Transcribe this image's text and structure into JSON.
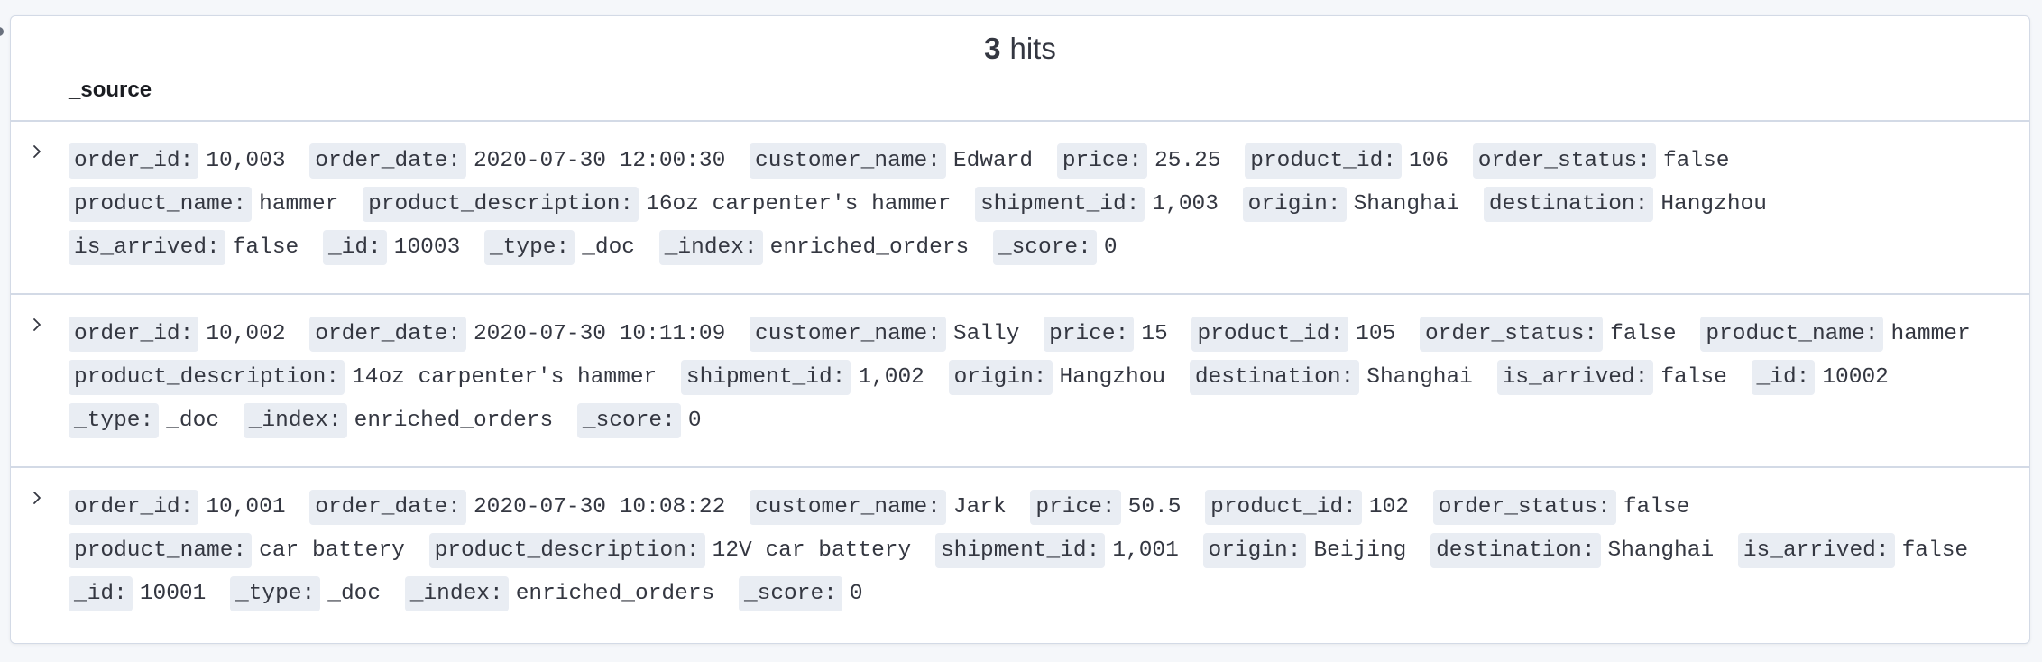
{
  "hits": {
    "count": "3",
    "label": "hits"
  },
  "table": {
    "column_header": "_source",
    "rows": [
      {
        "fields": [
          {
            "key": "order_id:",
            "value": "10,003"
          },
          {
            "key": "order_date:",
            "value": "2020-07-30 12:00:30"
          },
          {
            "key": "customer_name:",
            "value": "Edward"
          },
          {
            "key": "price:",
            "value": "25.25"
          },
          {
            "key": "product_id:",
            "value": "106"
          },
          {
            "key": "order_status:",
            "value": "false"
          },
          {
            "key": "product_name:",
            "value": "hammer"
          },
          {
            "key": "product_description:",
            "value": "16oz carpenter's hammer"
          },
          {
            "key": "shipment_id:",
            "value": "1,003"
          },
          {
            "key": "origin:",
            "value": "Shanghai"
          },
          {
            "key": "destination:",
            "value": "Hangzhou"
          },
          {
            "key": "is_arrived:",
            "value": "false"
          },
          {
            "key": "_id:",
            "value": "10003"
          },
          {
            "key": "_type:",
            "value": "_doc"
          },
          {
            "key": "_index:",
            "value": "enriched_orders"
          },
          {
            "key": "_score:",
            "value": "0"
          }
        ]
      },
      {
        "fields": [
          {
            "key": "order_id:",
            "value": "10,002"
          },
          {
            "key": "order_date:",
            "value": "2020-07-30 10:11:09"
          },
          {
            "key": "customer_name:",
            "value": "Sally"
          },
          {
            "key": "price:",
            "value": "15"
          },
          {
            "key": "product_id:",
            "value": "105"
          },
          {
            "key": "order_status:",
            "value": "false"
          },
          {
            "key": "product_name:",
            "value": "hammer"
          },
          {
            "key": "product_description:",
            "value": "14oz carpenter's hammer"
          },
          {
            "key": "shipment_id:",
            "value": "1,002"
          },
          {
            "key": "origin:",
            "value": "Hangzhou"
          },
          {
            "key": "destination:",
            "value": "Shanghai"
          },
          {
            "key": "is_arrived:",
            "value": "false"
          },
          {
            "key": "_id:",
            "value": "10002"
          },
          {
            "key": "_type:",
            "value": "_doc"
          },
          {
            "key": "_index:",
            "value": "enriched_orders"
          },
          {
            "key": "_score:",
            "value": "0"
          }
        ]
      },
      {
        "fields": [
          {
            "key": "order_id:",
            "value": "10,001"
          },
          {
            "key": "order_date:",
            "value": "2020-07-30 10:08:22"
          },
          {
            "key": "customer_name:",
            "value": "Jark"
          },
          {
            "key": "price:",
            "value": "50.5"
          },
          {
            "key": "product_id:",
            "value": "102"
          },
          {
            "key": "order_status:",
            "value": "false"
          },
          {
            "key": "product_name:",
            "value": "car battery"
          },
          {
            "key": "product_description:",
            "value": "12V car battery"
          },
          {
            "key": "shipment_id:",
            "value": "1,001"
          },
          {
            "key": "origin:",
            "value": "Beijing"
          },
          {
            "key": "destination:",
            "value": "Shanghai"
          },
          {
            "key": "is_arrived:",
            "value": "false"
          },
          {
            "key": "_id:",
            "value": "10001"
          },
          {
            "key": "_type:",
            "value": "_doc"
          },
          {
            "key": "_index:",
            "value": "enriched_orders"
          },
          {
            "key": "_score:",
            "value": "0"
          }
        ]
      }
    ]
  },
  "icons": {
    "row_expander": "chevron-right-icon"
  },
  "colors": {
    "key_background": "#e9edf3",
    "border": "#d3dae6",
    "text": "#343741"
  }
}
